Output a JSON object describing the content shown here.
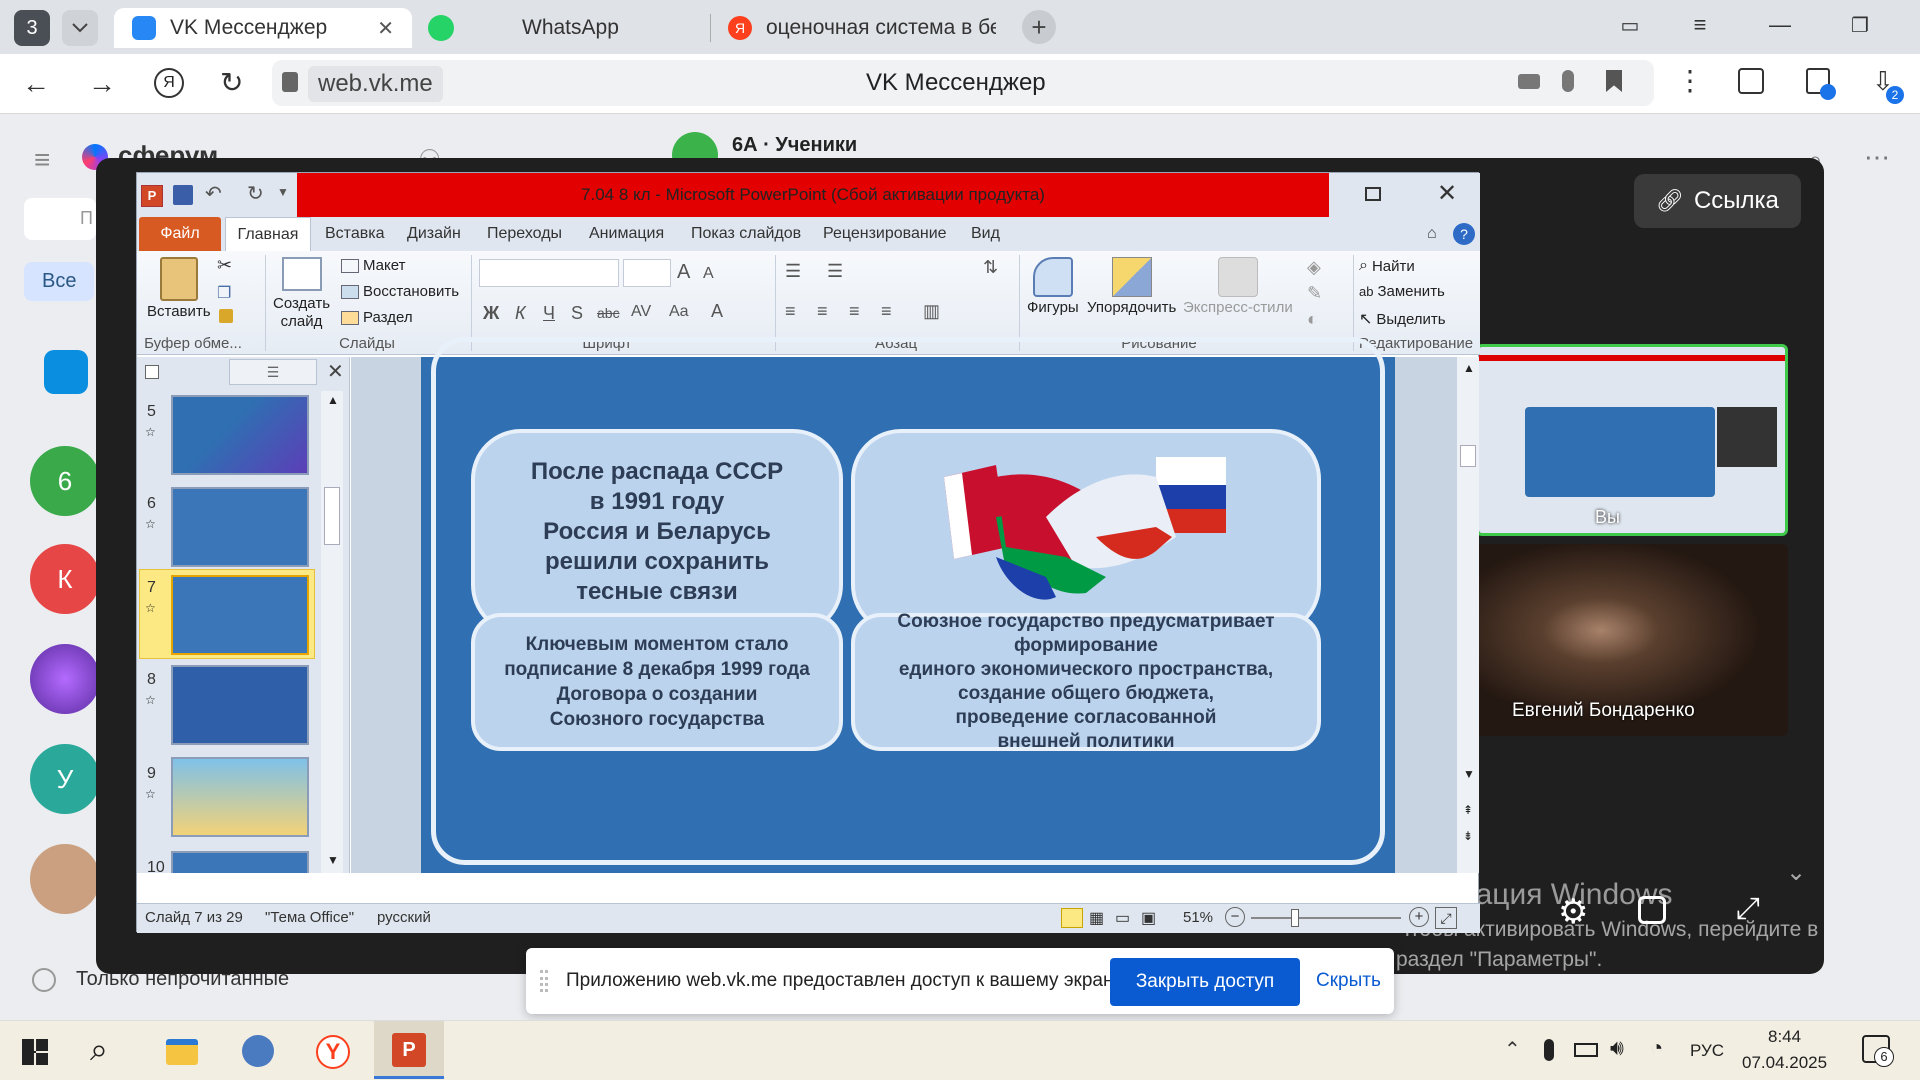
{
  "browser": {
    "tab_count": "3",
    "tabs": [
      {
        "label": "VK Мессенджер"
      },
      {
        "label": "WhatsApp"
      },
      {
        "label": "оценочная система в бел"
      }
    ],
    "url": "web.vk.me",
    "page_title": "VK Мессенджер",
    "downloads_badge": "2"
  },
  "vk": {
    "logo": "сферум",
    "chat_header": "6А · Ученики",
    "filter_all": "Все",
    "search_placeholder": "П",
    "only_unread": "Только непрочитанные",
    "avatars": [
      "6",
      "К",
      "У"
    ]
  },
  "call": {
    "link_button": "Ссылка",
    "you_label": "Вы",
    "participant_name": "Евгений Бондаренко",
    "windows_activation_title": "Активация Windows",
    "windows_activation_text_1": "Чтобы активировать Windows, перейдите в",
    "windows_activation_text_2": "раздел \"Параметры\"."
  },
  "ppt": {
    "title": "7.04 8 кл - Microsoft PowerPoint (Сбой активации продукта)",
    "tabs": [
      "Файл",
      "Главная",
      "Вставка",
      "Дизайн",
      "Переходы",
      "Анимация",
      "Показ слайдов",
      "Рецензирование",
      "Вид"
    ],
    "ribbon": {
      "paste": "Вставить",
      "clipboard_group": "Буфер обме...",
      "new_slide_1": "Создать",
      "new_slide_2": "слайд",
      "layout": "Макет",
      "restore": "Восстановить",
      "section": "Раздел",
      "slides_group": "Слайды",
      "font_group": "Шрифт",
      "paragraph_group": "Абзац",
      "shapes": "Фигуры",
      "arrange": "Упорядочить",
      "quick_styles": "Экспресс-стили",
      "drawing_group": "Рисование",
      "find": "Найти",
      "replace": "Заменить",
      "select": "Выделить",
      "editing_group": "Редактирование"
    },
    "thumbnails": [
      "5",
      "6",
      "7",
      "8",
      "9",
      "10"
    ],
    "slide": {
      "card1": [
        "После распада СССР",
        "в 1991 году",
        "Россия и Беларусь",
        "решили сохранить",
        "тесные связи"
      ],
      "card3": [
        "Ключевым моментом стало",
        "подписание 8 декабря 1999 года",
        "Договора о создании",
        "Союзного государства"
      ],
      "card4": [
        "Союзное государство предусматривает",
        "формирование",
        "единого экономического пространства,",
        "создание общего бюджета,",
        "проведение согласованной",
        "внешней политики"
      ]
    },
    "status": {
      "slide_info": "Слайд 7 из 29",
      "theme": "\"Тема Office\"",
      "language": "русский",
      "zoom": "51%"
    }
  },
  "share_notice": {
    "text": "Приложению web.vk.me предоставлен доступ к вашему экрану.",
    "stop_button": "Закрыть доступ",
    "hide_button": "Скрыть"
  },
  "taskbar": {
    "language": "РУС",
    "time": "8:44",
    "date": "07.04.2025",
    "notifications": "6"
  },
  "colors": {
    "vk_blue": "#0077ff",
    "ppt_title_red": "#e20000",
    "slide_bg": "#2f6fb2",
    "card_bg": "#bcd3ee",
    "active_speaker": "#3ec94a"
  }
}
